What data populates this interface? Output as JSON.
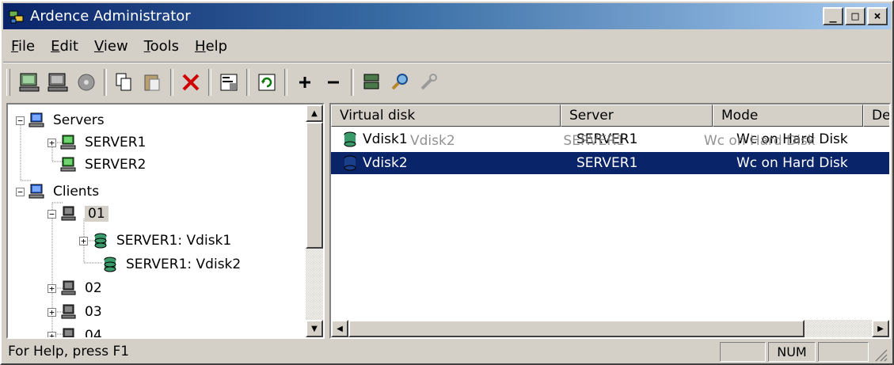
{
  "window": {
    "title": "Ardence Administrator"
  },
  "title_buttons": {
    "minimize": "_",
    "maximize": "□",
    "close": "×"
  },
  "menu": [
    {
      "label": "File"
    },
    {
      "label": "Edit"
    },
    {
      "label": "View"
    },
    {
      "label": "Tools"
    },
    {
      "label": "Help"
    }
  ],
  "toolbar_icons": [
    "add-server-icon",
    "add-client-icon",
    "disk-icon",
    "copy-icon",
    "paste-icon",
    "delete-icon",
    "properties-icon",
    "refresh-icon",
    "plus-icon",
    "minus-icon",
    "server-disk-icon",
    "search-icon",
    "tools-icon"
  ],
  "tree": {
    "servers": "Servers",
    "server1": "SERVER1",
    "server2": "SERVER2",
    "clients": "Clients",
    "client01": "01",
    "vdisk1": "SERVER1: Vdisk1",
    "vdisk2": "SERVER1: Vdisk2",
    "client02": "02",
    "client03": "03",
    "client04": "04"
  },
  "list": {
    "columns": [
      "Virtual disk",
      "Server",
      "Mode",
      "De"
    ],
    "rows": [
      {
        "disk": "Vdisk1",
        "server": "SERVER1",
        "mode": "Wc on Hard Disk",
        "selected": false
      },
      {
        "disk": "Vdisk2",
        "server": "SERVER1",
        "mode": "Wc on Hard Disk",
        "selected": true
      }
    ],
    "drag_ghost": {
      "disk": "Vdisk2",
      "server": "SERVER1",
      "mode": "Wc on Hard Disk"
    }
  },
  "status": {
    "help": "For Help, press F1",
    "num": "NUM"
  },
  "colors": {
    "title_start": "#0a246a",
    "title_end": "#a6caf0",
    "selection": "#0a246a",
    "face": "#d4d0c8"
  }
}
